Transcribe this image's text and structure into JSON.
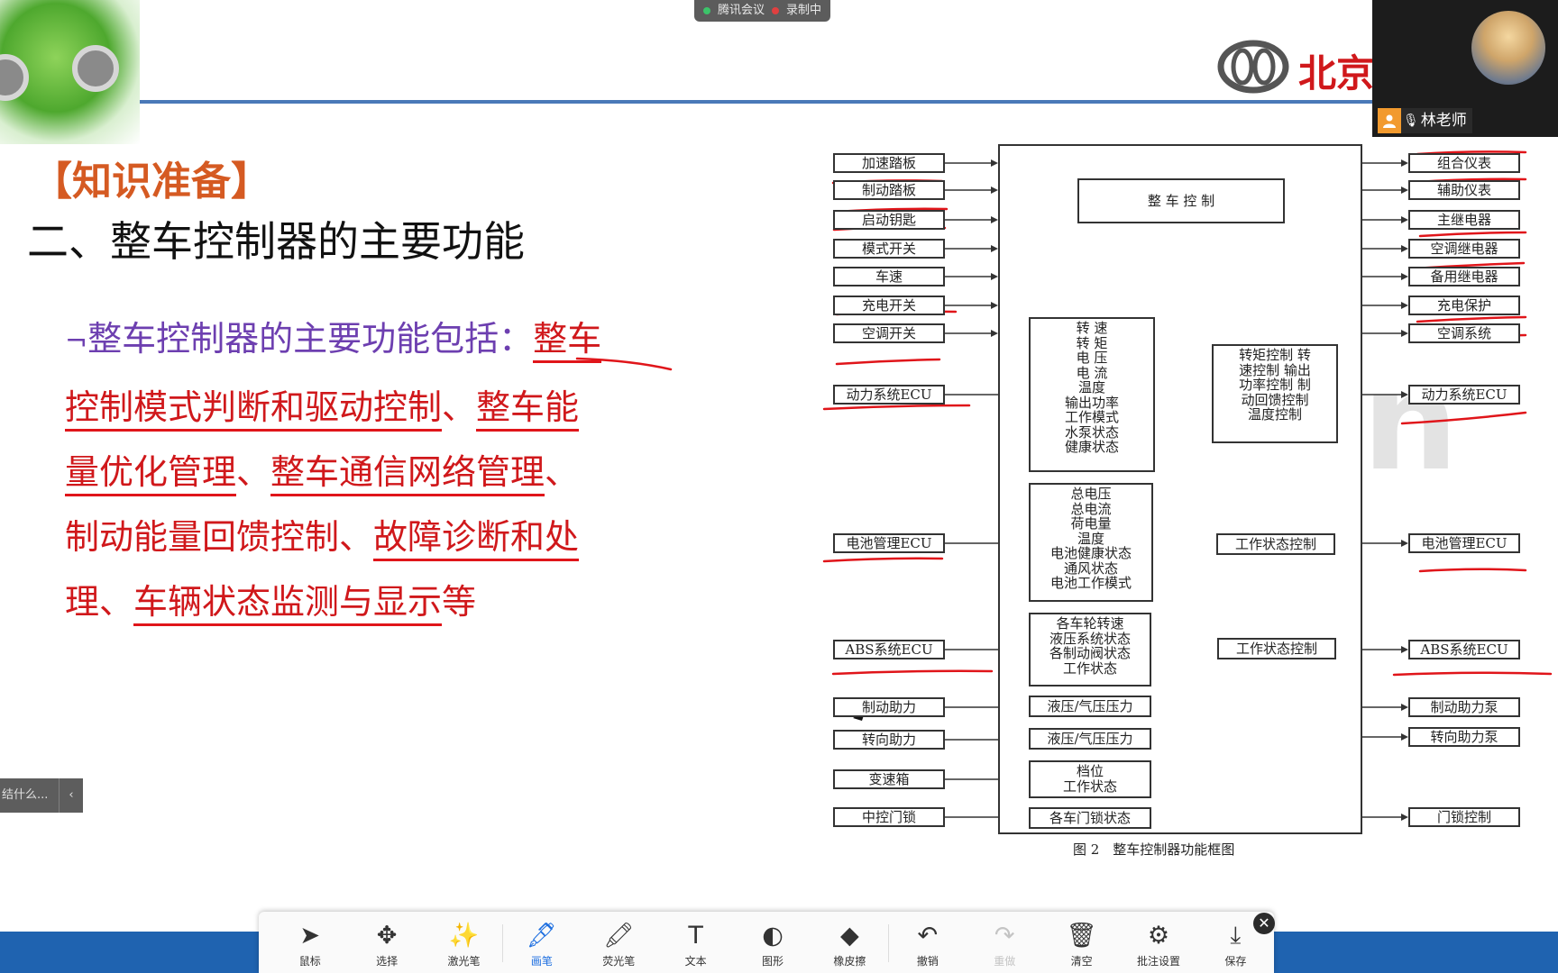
{
  "meeting_bar": {
    "app": "腾讯会议",
    "rec": "录制中",
    "app_dot_color": "#3cc46a",
    "rec_dot_color": "#e04040"
  },
  "video": {
    "name": "林老师"
  },
  "slide": {
    "brand": "北京",
    "section": "【知识准备】",
    "title": "二、整车控制器的主要功能",
    "arrow": "¬",
    "lead": "整车控制器的主要功能包括：",
    "parts": [
      "整车",
      "控制模式判断和驱动控制",
      "、",
      "整车能",
      "量优化管理",
      "、",
      "整车通信网络管理",
      "、",
      "制动能量回馈控制",
      "、",
      "故障诊断和处",
      "理",
      "、",
      "车辆状态监测与显示",
      "等"
    ]
  },
  "diagram": {
    "caption": "图 2　整车控制器功能框图",
    "center_title": "整 车 控 制",
    "left_inputs": [
      "加速踏板",
      "制动踏板",
      "启动钥匙",
      "模式开关",
      "车速",
      "充电开关",
      "空调开关",
      "动力系统ECU",
      "电池管理ECU",
      "ABS系统ECU",
      "制动助力",
      "转向助力",
      "变速箱",
      "中控门锁"
    ],
    "mid_blocks": [
      {
        "lines": [
          "转 速",
          "转 矩",
          "电 压",
          "电 流",
          "温度",
          "输出功率",
          "工作模式",
          "水泵状态",
          "健康状态"
        ]
      },
      {
        "lines": [
          "总电压",
          "总电流",
          "荷电量",
          "温度",
          "电池健康状态",
          "通风状态",
          "电池工作模式"
        ]
      },
      {
        "lines": [
          "各车轮转速",
          "液压系统状态",
          "各制动阀状态",
          "工作状态"
        ]
      },
      {
        "lines": [
          "液压/气压压力"
        ]
      },
      {
        "lines": [
          "液压/气压压力"
        ]
      },
      {
        "lines": [
          "档位",
          "工作状态"
        ]
      },
      {
        "lines": [
          "各车门锁状态"
        ]
      }
    ],
    "right_blocks": [
      {
        "lines": [
          "转矩控制  转",
          "速控制  输出",
          "功率控制  制",
          "动回馈控制",
          "温度控制"
        ]
      },
      {
        "lines": [
          "工作状态控制"
        ]
      },
      {
        "lines": [
          "工作状态控制"
        ]
      }
    ],
    "right_outputs": [
      "组合仪表",
      "辅助仪表",
      "主继电器",
      "空调继电器",
      "备用继电器",
      "充电保护",
      "空调系统",
      "动力系统ECU",
      "电池管理ECU",
      "ABS系统ECU",
      "制动助力泵",
      "转向助力泵",
      "门锁控制"
    ]
  },
  "side_pill": {
    "text": "结什么...",
    "chevron": "‹"
  },
  "toolbar": [
    {
      "label": "鼠标",
      "icon": "cursor-icon"
    },
    {
      "label": "选择",
      "icon": "move-icon"
    },
    {
      "label": "激光笔",
      "icon": "laser-icon"
    },
    {
      "label": "画笔",
      "icon": "pen-icon",
      "active": true
    },
    {
      "label": "荧光笔",
      "icon": "highlighter-icon"
    },
    {
      "label": "文本",
      "icon": "text-icon"
    },
    {
      "label": "图形",
      "icon": "shape-icon"
    },
    {
      "label": "橡皮擦",
      "icon": "eraser-icon"
    },
    {
      "label": "撤销",
      "icon": "undo-icon"
    },
    {
      "label": "重做",
      "icon": "redo-icon",
      "disabled": true
    },
    {
      "label": "清空",
      "icon": "trash-icon"
    },
    {
      "label": "批注设置",
      "icon": "annotate-settings-icon"
    },
    {
      "label": "保存",
      "icon": "save-icon"
    }
  ]
}
